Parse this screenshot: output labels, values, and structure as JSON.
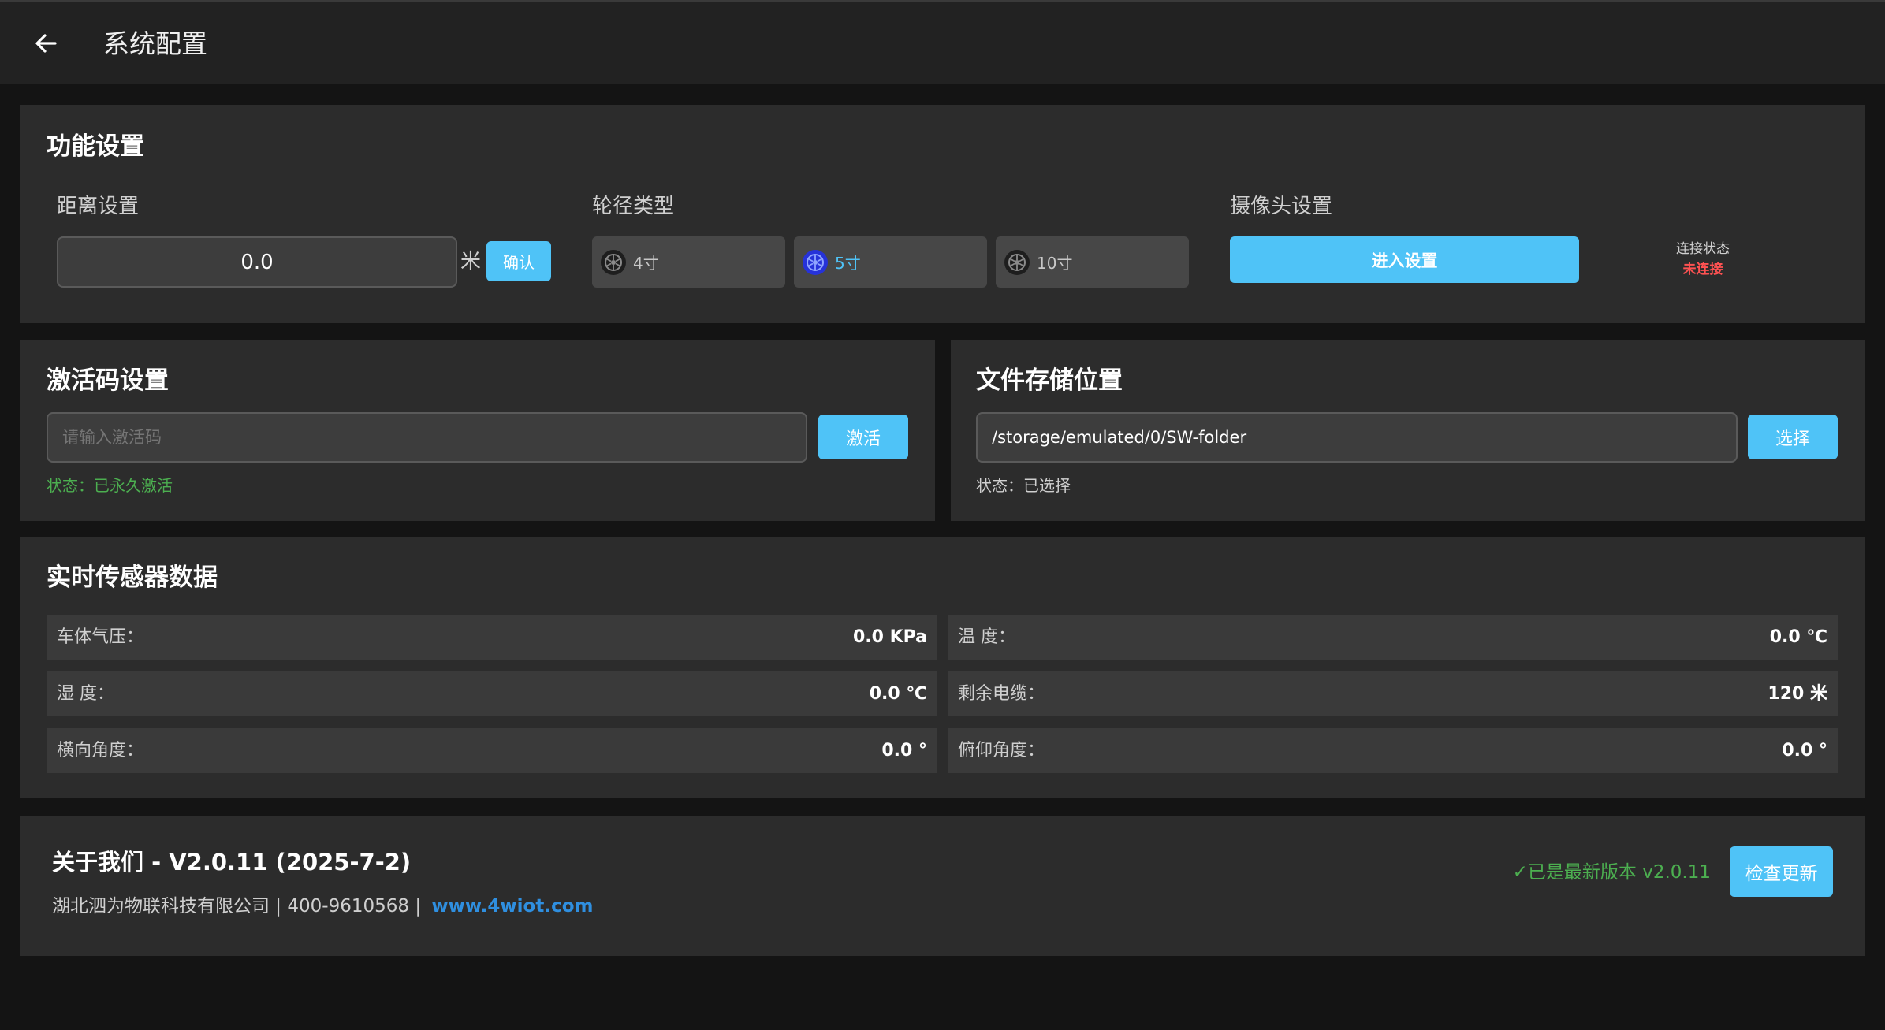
{
  "header": {
    "title": "系统配置"
  },
  "function_settings": {
    "title": "功能设置",
    "distance": {
      "label": "距离设置",
      "value": "0.0",
      "unit": "米",
      "confirm_label": "确认"
    },
    "wheel": {
      "label": "轮径类型",
      "options": [
        {
          "label": "4寸",
          "selected": false
        },
        {
          "label": "5寸",
          "selected": true
        },
        {
          "label": "10寸",
          "selected": false
        }
      ]
    },
    "camera": {
      "label": "摄像头设置",
      "button_label": "进入设置",
      "conn_label": "连接状态",
      "conn_status": "未连接",
      "conn_status_color": "#ff5252"
    }
  },
  "activation": {
    "title": "激活码设置",
    "placeholder": "请输入激活码",
    "value": "",
    "button_label": "激活",
    "status": "状态：已永久激活",
    "status_color": "#4caf50"
  },
  "storage": {
    "title": "文件存储位置",
    "path": "/storage/emulated/0/SW-folder",
    "button_label": "选择",
    "status": "状态：已选择"
  },
  "sensors": {
    "title": "实时传感器数据",
    "rows": [
      {
        "key": "车体气压：",
        "value": "0.0 KPa"
      },
      {
        "key": "温 度：",
        "value": "0.0 ℃"
      },
      {
        "key": "湿 度：",
        "value": "0.0 ℃"
      },
      {
        "key": "剩余电缆：",
        "value": "120 米"
      },
      {
        "key": "横向角度：",
        "value": "0.0 °"
      },
      {
        "key": "俯仰角度：",
        "value": "0.0 °"
      }
    ]
  },
  "about": {
    "title": "关于我们 - V2.0.11 (2025-7-2)",
    "company_line": "湖北泗为物联科技有限公司 | 400-9610568 |",
    "website": "www.4wiot.com",
    "version_status": "✓已是最新版本 v2.0.11",
    "check_update_label": "检查更新"
  },
  "colors": {
    "accent": "#4fc3f7",
    "link": "#2f8fe0",
    "success": "#4caf50",
    "error": "#ff5252",
    "selected_wheel": "#3b4cff"
  }
}
